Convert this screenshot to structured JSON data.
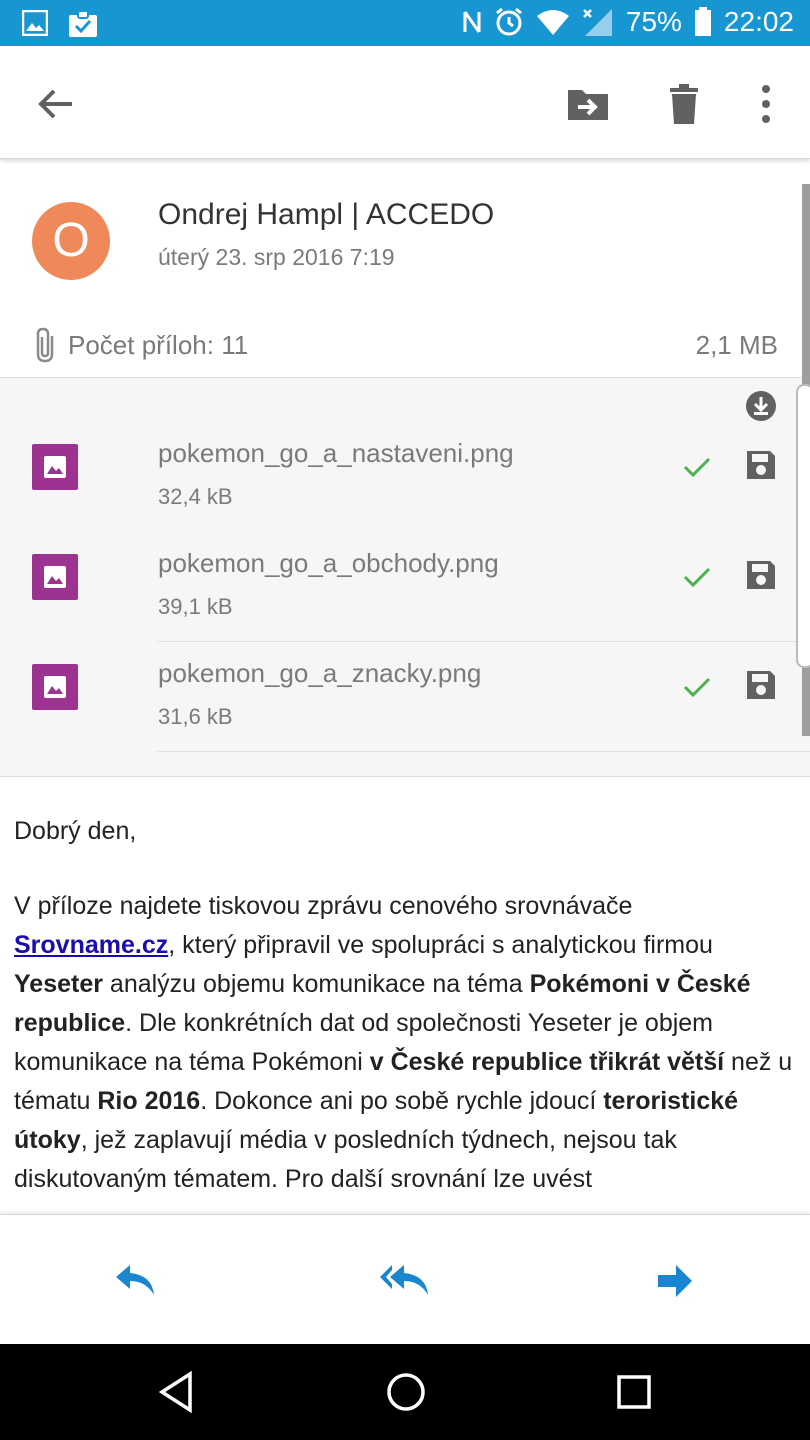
{
  "status_bar": {
    "battery": "75%",
    "time": "22:02",
    "icons_left": [
      "image-icon",
      "clipboard-check-icon"
    ],
    "icons_right": [
      "nfc-icon",
      "alarm-icon",
      "wifi-icon",
      "signal-icon",
      "battery-icon"
    ]
  },
  "toolbar": {
    "icons": [
      "back-arrow-icon",
      "move-to-folder-icon",
      "delete-icon",
      "more-options-icon"
    ]
  },
  "message": {
    "avatar_letter": "O",
    "avatar_color": "#f0895a",
    "sender": "Ondrej Hampl | ACCEDO",
    "date": "úterý 23. srp 2016 7:19",
    "attachment_count_label": "Počet příloh: 11",
    "total_size": "2,1 MB"
  },
  "attachments": [
    {
      "name": "pokemon_go_a_nastaveni.png",
      "size": "32,4 kB"
    },
    {
      "name": "pokemon_go_a_obchody.png",
      "size": "39,1 kB"
    },
    {
      "name": "pokemon_go_a_znacky.png",
      "size": "31,6 kB"
    }
  ],
  "body": {
    "greeting": "Dobrý den,",
    "p_t1": "V příloze najdete tiskovou zprávu cenového srovnávače ",
    "p_link": "Srovname.cz",
    "p_t2": ", který připravil ve spolupráci s analytickou firmou ",
    "p_b1": "Yeseter",
    "p_t3": " analýzu objemu komunikace na téma ",
    "p_b2": "Pokémoni v České republice",
    "p_t4": ". Dle konkrétních dat od společnosti Yeseter je objem komunikace na téma Pokémoni ",
    "p_b3": "v České republice třikrát větší",
    "p_t5": " než u tématu ",
    "p_b4": "Rio 2016",
    "p_t6": ". Dokonce ani po sobě rychle jdoucí ",
    "p_b5": "teroristické útoky",
    "p_t7": ", jež zaplavují média v posledních týdnech, nejsou tak diskutovaným tématem. Pro další srovnání lze uvést"
  },
  "colors": {
    "status_bar": "#1796d2",
    "accent_blue": "#1a86d0",
    "attachment_thumb": "#9c3390",
    "check_green": "#4caf50"
  }
}
